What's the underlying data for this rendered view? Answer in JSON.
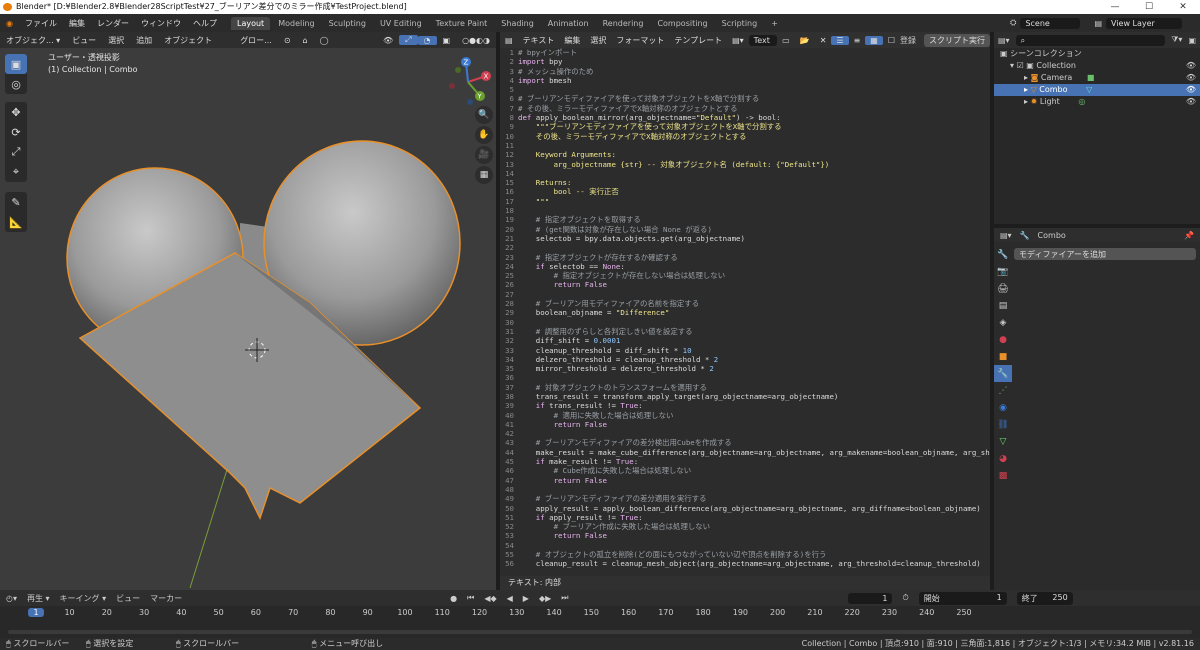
{
  "window": {
    "title": "Blender* [D:¥Blender2.8¥Blender28ScriptTest¥27_ブーリアン差分でのミラー作成¥TestProject.blend]",
    "buttons": [
      "—",
      "☐",
      "✕"
    ]
  },
  "menu": [
    "ファイル",
    "編集",
    "レンダー",
    "ウィンドウ",
    "ヘルプ"
  ],
  "workspaces": [
    "Layout",
    "Modeling",
    "Sculpting",
    "UV Editing",
    "Texture Paint",
    "Shading",
    "Animation",
    "Rendering",
    "Compositing",
    "Scripting",
    "+"
  ],
  "scene": "Scene",
  "view_layer": "View Layer",
  "viewport": {
    "header": [
      "オブジェク... ▾",
      "ビュー",
      "選択",
      "追加",
      "オブジェクト"
    ],
    "transform": "グロー...",
    "overlay_title": "ユーザー・透視投影",
    "overlay_sub": "(1) Collection | Combo",
    "tools": [
      "▣",
      "◎",
      "✥",
      "⟳",
      "⤢",
      "⌖",
      "✎",
      "📐"
    ],
    "gizmo": {
      "x": "X",
      "y": "Y",
      "z": "Z"
    },
    "nav": [
      "🔍",
      "✋",
      "🎥",
      "▦"
    ]
  },
  "text_editor": {
    "header": [
      "テキスト",
      "編集",
      "選択",
      "フォーマット",
      "テンプレート"
    ],
    "filename": "Text",
    "register": "登録",
    "run": "スクリプト実行",
    "footer": "テキスト: 内部",
    "lines": [
      [
        {
          "c": "com",
          "t": "# bpyインポート"
        }
      ],
      [
        {
          "c": "kw",
          "t": "import"
        },
        {
          "c": "t",
          "t": " bpy"
        }
      ],
      [
        {
          "c": "com",
          "t": "# メッシュ操作のため"
        }
      ],
      [
        {
          "c": "kw",
          "t": "import"
        },
        {
          "c": "t",
          "t": " bmesh"
        }
      ],
      [],
      [
        {
          "c": "com",
          "t": "# ブーリアンモディファイアを使って対象オブジェクトをX軸で分割する"
        }
      ],
      [
        {
          "c": "com",
          "t": "# その後、ミラーモディファイアでX軸対称のオブジェクトとする"
        }
      ],
      [
        {
          "c": "kw",
          "t": "def"
        },
        {
          "c": "t",
          "t": " apply_boolean_mirror(arg_objectname="
        },
        {
          "c": "str",
          "t": "\"Default\""
        },
        {
          "c": "t",
          "t": ") -> bool:"
        }
      ],
      [
        {
          "c": "str",
          "t": "    \"\"\"ブーリアンモディファイアを使って対象オブジェクトをX軸で分割する"
        }
      ],
      [
        {
          "c": "str",
          "t": "    その後、ミラーモディファイアでX軸対称のオブジェクトとする"
        }
      ],
      [],
      [
        {
          "c": "str",
          "t": "    Keyword Arguments:"
        }
      ],
      [
        {
          "c": "str",
          "t": "        arg_objectname {str} -- 対象オブジェクト名 (default: {\"Default\"})"
        }
      ],
      [],
      [
        {
          "c": "str",
          "t": "    Returns:"
        }
      ],
      [
        {
          "c": "str",
          "t": "        bool -- 実行正否"
        }
      ],
      [
        {
          "c": "str",
          "t": "    \"\"\""
        }
      ],
      [],
      [
        {
          "c": "com",
          "t": "    # 指定オブジェクトを取得する"
        }
      ],
      [
        {
          "c": "com",
          "t": "    # (get関数は対象が存在しない場合 None が返る)"
        }
      ],
      [
        {
          "c": "t",
          "t": "    selectob = bpy.data.objects.get(arg_objectname)"
        }
      ],
      [],
      [
        {
          "c": "com",
          "t": "    # 指定オブジェクトが存在するか確認する"
        }
      ],
      [
        {
          "c": "kw",
          "t": "    if"
        },
        {
          "c": "t",
          "t": " selectob == "
        },
        {
          "c": "kw",
          "t": "None"
        },
        {
          "c": "t",
          "t": ":"
        }
      ],
      [
        {
          "c": "com",
          "t": "        # 指定オブジェクトが存在しない場合は処理しない"
        }
      ],
      [
        {
          "c": "kw",
          "t": "        return False"
        }
      ],
      [],
      [
        {
          "c": "com",
          "t": "    # ブーリアン用モディファイアの名前を指定する"
        }
      ],
      [
        {
          "c": "t",
          "t": "    boolean_objname = "
        },
        {
          "c": "str",
          "t": "\"Difference\""
        }
      ],
      [],
      [
        {
          "c": "com",
          "t": "    # 調整用のずらしと各判定しきい値を設定する"
        }
      ],
      [
        {
          "c": "t",
          "t": "    diff_shift = "
        },
        {
          "c": "num",
          "t": "0.0001"
        }
      ],
      [
        {
          "c": "t",
          "t": "    cleanup_threshold = diff_shift * "
        },
        {
          "c": "num",
          "t": "10"
        }
      ],
      [
        {
          "c": "t",
          "t": "    delzero_threshold = cleanup_threshold * "
        },
        {
          "c": "num",
          "t": "2"
        }
      ],
      [
        {
          "c": "t",
          "t": "    mirror_threshold = delzero_threshold * "
        },
        {
          "c": "num",
          "t": "2"
        }
      ],
      [],
      [
        {
          "c": "com",
          "t": "    # 対象オブジェクトのトランスフォームを適用する"
        }
      ],
      [
        {
          "c": "t",
          "t": "    trans_result = transform_apply_target(arg_objectname=arg_objectname)"
        }
      ],
      [
        {
          "c": "kw",
          "t": "    if"
        },
        {
          "c": "t",
          "t": " trans_result != "
        },
        {
          "c": "kw",
          "t": "True"
        },
        {
          "c": "t",
          "t": ":"
        }
      ],
      [
        {
          "c": "com",
          "t": "        # 適用に失敗した場合は処理しない"
        }
      ],
      [
        {
          "c": "kw",
          "t": "        return False"
        }
      ],
      [],
      [
        {
          "c": "com",
          "t": "    # ブーリアンモディファイアの差分検出用Cubeを作成する"
        }
      ],
      [
        {
          "c": "t",
          "t": "    make_result = make_cube_difference(arg_objectname=arg_objectname, arg_makename=boolean_objname, arg_sh:"
        }
      ],
      [
        {
          "c": "kw",
          "t": "    if"
        },
        {
          "c": "t",
          "t": " make_result != "
        },
        {
          "c": "kw",
          "t": "True"
        },
        {
          "c": "t",
          "t": ":"
        }
      ],
      [
        {
          "c": "com",
          "t": "        # Cube作成に失敗した場合は処理しない"
        }
      ],
      [
        {
          "c": "kw",
          "t": "        return False"
        }
      ],
      [],
      [
        {
          "c": "com",
          "t": "    # ブーリアンモディファイアの差分適用を実行する"
        }
      ],
      [
        {
          "c": "t",
          "t": "    apply_result = apply_boolean_difference(arg_objectname=arg_objectname, arg_diffname=boolean_objname)"
        }
      ],
      [
        {
          "c": "kw",
          "t": "    if"
        },
        {
          "c": "t",
          "t": " apply_result != "
        },
        {
          "c": "kw",
          "t": "True"
        },
        {
          "c": "t",
          "t": ":"
        }
      ],
      [
        {
          "c": "com",
          "t": "        # ブーリアン作成に失敗した場合は処理しない"
        }
      ],
      [
        {
          "c": "kw",
          "t": "        return False"
        }
      ],
      [],
      [
        {
          "c": "com",
          "t": "    # オブジェクトの孤立を削除(どの面にもつながっていない辺や頂点を削除する)を行う"
        }
      ],
      [
        {
          "c": "t",
          "t": "    cleanup_result = cleanup_mesh_object(arg_objectname=arg_objectname, arg_threshold=cleanup_threshold)"
        }
      ]
    ]
  },
  "outliner": {
    "root": "シーンコレクション",
    "collection": "Collection",
    "items": [
      {
        "name": "Camera",
        "selected": false
      },
      {
        "name": "Combo",
        "selected": true
      },
      {
        "name": "Light",
        "selected": false
      }
    ]
  },
  "properties": {
    "object": "Combo",
    "add_modifier": "モディファイアーを追加"
  },
  "timeline": {
    "menu": [
      "再生 ▾",
      "キーイング ▾",
      "ビュー",
      "マーカー"
    ],
    "current_frame": "1",
    "start_label": "開始",
    "start": "1",
    "end_label": "終了",
    "end": "250",
    "ticks": [
      "1",
      "10",
      "20",
      "30",
      "40",
      "50",
      "60",
      "70",
      "80",
      "90",
      "100",
      "110",
      "120",
      "130",
      "140",
      "150",
      "160",
      "170",
      "180",
      "190",
      "200",
      "210",
      "220",
      "230",
      "240",
      "250"
    ]
  },
  "status": {
    "left": [
      "スクロールバー",
      "選択を設定",
      "スクロールバー",
      "メニュー呼び出し"
    ],
    "right": "Collection | Combo | 頂点:910 | 面:910 | 三角面:1,816 | オブジェクト:1/3 | メモリ:34.2 MiB | v2.81.16"
  }
}
